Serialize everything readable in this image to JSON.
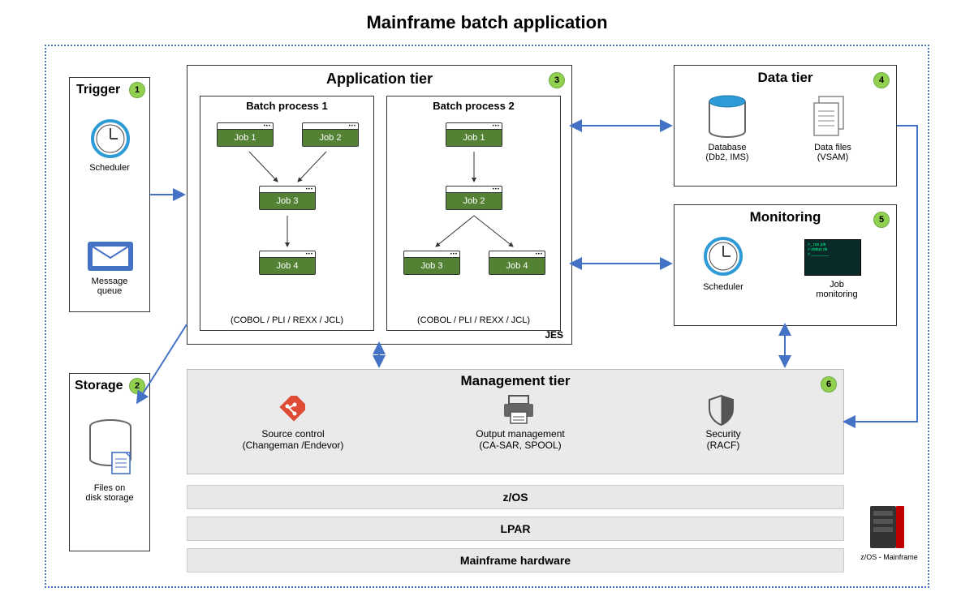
{
  "title": "Mainframe batch application",
  "badges": {
    "b1": "1",
    "b2": "2",
    "b3": "3",
    "b4": "4",
    "b5": "5",
    "b6": "6"
  },
  "trigger": {
    "title": "Trigger",
    "scheduler": "Scheduler",
    "mq": "Message\nqueue"
  },
  "storage": {
    "title": "Storage",
    "files": "Files on\ndisk storage"
  },
  "app": {
    "title": "Application tier",
    "bp1": "Batch process 1",
    "bp2": "Batch process 2",
    "j1": "Job 1",
    "j2": "Job 2",
    "j3": "Job 3",
    "j4": "Job 4",
    "langs": "(COBOL / PLI / REXX / JCL)",
    "jes": "JES"
  },
  "data": {
    "title": "Data tier",
    "db": "Database\n(Db2, IMS)",
    "files": "Data files\n(VSAM)"
  },
  "monitoring": {
    "title": "Monitoring",
    "scheduler": "Scheduler",
    "job": "Job\nmonitoring"
  },
  "mgmt": {
    "title": "Management tier",
    "src": "Source control\n(Changeman /Endevor)",
    "out": "Output management\n(CA-SAR, SPOOL)",
    "sec": "Security\n(RACF)"
  },
  "layers": {
    "zos": "z/OS",
    "lpar": "LPAR",
    "hw": "Mainframe hardware"
  },
  "server": "z/OS - Mainframe"
}
